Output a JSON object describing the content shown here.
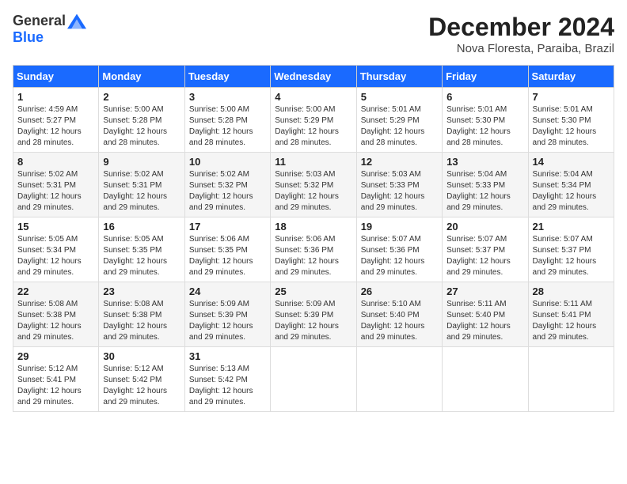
{
  "logo": {
    "general": "General",
    "blue": "Blue"
  },
  "title": {
    "month_year": "December 2024",
    "location": "Nova Floresta, Paraiba, Brazil"
  },
  "weekdays": [
    "Sunday",
    "Monday",
    "Tuesday",
    "Wednesday",
    "Thursday",
    "Friday",
    "Saturday"
  ],
  "weeks": [
    [
      {
        "day": "1",
        "sunrise": "4:59 AM",
        "sunset": "5:27 PM",
        "daylight": "12 hours and 28 minutes."
      },
      {
        "day": "2",
        "sunrise": "5:00 AM",
        "sunset": "5:28 PM",
        "daylight": "12 hours and 28 minutes."
      },
      {
        "day": "3",
        "sunrise": "5:00 AM",
        "sunset": "5:28 PM",
        "daylight": "12 hours and 28 minutes."
      },
      {
        "day": "4",
        "sunrise": "5:00 AM",
        "sunset": "5:29 PM",
        "daylight": "12 hours and 28 minutes."
      },
      {
        "day": "5",
        "sunrise": "5:01 AM",
        "sunset": "5:29 PM",
        "daylight": "12 hours and 28 minutes."
      },
      {
        "day": "6",
        "sunrise": "5:01 AM",
        "sunset": "5:30 PM",
        "daylight": "12 hours and 28 minutes."
      },
      {
        "day": "7",
        "sunrise": "5:01 AM",
        "sunset": "5:30 PM",
        "daylight": "12 hours and 28 minutes."
      }
    ],
    [
      {
        "day": "8",
        "sunrise": "5:02 AM",
        "sunset": "5:31 PM",
        "daylight": "12 hours and 29 minutes."
      },
      {
        "day": "9",
        "sunrise": "5:02 AM",
        "sunset": "5:31 PM",
        "daylight": "12 hours and 29 minutes."
      },
      {
        "day": "10",
        "sunrise": "5:02 AM",
        "sunset": "5:32 PM",
        "daylight": "12 hours and 29 minutes."
      },
      {
        "day": "11",
        "sunrise": "5:03 AM",
        "sunset": "5:32 PM",
        "daylight": "12 hours and 29 minutes."
      },
      {
        "day": "12",
        "sunrise": "5:03 AM",
        "sunset": "5:33 PM",
        "daylight": "12 hours and 29 minutes."
      },
      {
        "day": "13",
        "sunrise": "5:04 AM",
        "sunset": "5:33 PM",
        "daylight": "12 hours and 29 minutes."
      },
      {
        "day": "14",
        "sunrise": "5:04 AM",
        "sunset": "5:34 PM",
        "daylight": "12 hours and 29 minutes."
      }
    ],
    [
      {
        "day": "15",
        "sunrise": "5:05 AM",
        "sunset": "5:34 PM",
        "daylight": "12 hours and 29 minutes."
      },
      {
        "day": "16",
        "sunrise": "5:05 AM",
        "sunset": "5:35 PM",
        "daylight": "12 hours and 29 minutes."
      },
      {
        "day": "17",
        "sunrise": "5:06 AM",
        "sunset": "5:35 PM",
        "daylight": "12 hours and 29 minutes."
      },
      {
        "day": "18",
        "sunrise": "5:06 AM",
        "sunset": "5:36 PM",
        "daylight": "12 hours and 29 minutes."
      },
      {
        "day": "19",
        "sunrise": "5:07 AM",
        "sunset": "5:36 PM",
        "daylight": "12 hours and 29 minutes."
      },
      {
        "day": "20",
        "sunrise": "5:07 AM",
        "sunset": "5:37 PM",
        "daylight": "12 hours and 29 minutes."
      },
      {
        "day": "21",
        "sunrise": "5:07 AM",
        "sunset": "5:37 PM",
        "daylight": "12 hours and 29 minutes."
      }
    ],
    [
      {
        "day": "22",
        "sunrise": "5:08 AM",
        "sunset": "5:38 PM",
        "daylight": "12 hours and 29 minutes."
      },
      {
        "day": "23",
        "sunrise": "5:08 AM",
        "sunset": "5:38 PM",
        "daylight": "12 hours and 29 minutes."
      },
      {
        "day": "24",
        "sunrise": "5:09 AM",
        "sunset": "5:39 PM",
        "daylight": "12 hours and 29 minutes."
      },
      {
        "day": "25",
        "sunrise": "5:09 AM",
        "sunset": "5:39 PM",
        "daylight": "12 hours and 29 minutes."
      },
      {
        "day": "26",
        "sunrise": "5:10 AM",
        "sunset": "5:40 PM",
        "daylight": "12 hours and 29 minutes."
      },
      {
        "day": "27",
        "sunrise": "5:11 AM",
        "sunset": "5:40 PM",
        "daylight": "12 hours and 29 minutes."
      },
      {
        "day": "28",
        "sunrise": "5:11 AM",
        "sunset": "5:41 PM",
        "daylight": "12 hours and 29 minutes."
      }
    ],
    [
      {
        "day": "29",
        "sunrise": "5:12 AM",
        "sunset": "5:41 PM",
        "daylight": "12 hours and 29 minutes."
      },
      {
        "day": "30",
        "sunrise": "5:12 AM",
        "sunset": "5:42 PM",
        "daylight": "12 hours and 29 minutes."
      },
      {
        "day": "31",
        "sunrise": "5:13 AM",
        "sunset": "5:42 PM",
        "daylight": "12 hours and 29 minutes."
      },
      null,
      null,
      null,
      null
    ]
  ],
  "labels": {
    "sunrise": "Sunrise:",
    "sunset": "Sunset:",
    "daylight": "Daylight: "
  }
}
